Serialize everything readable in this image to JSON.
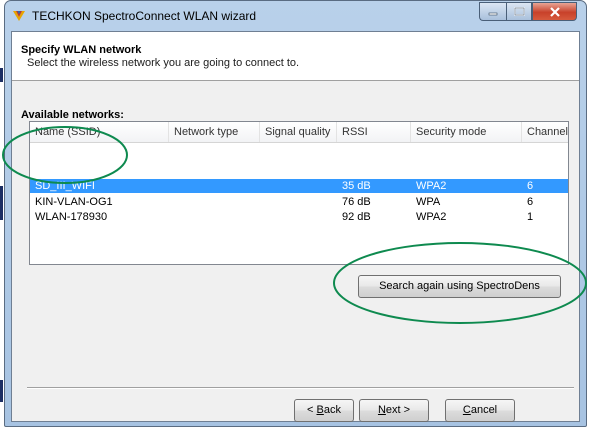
{
  "window": {
    "title": "TECHKON SpectroConnect WLAN wizard",
    "controls": {
      "minimize": "–",
      "maximize": "□",
      "close": "✕"
    }
  },
  "header": {
    "title": "Specify WLAN network",
    "subtitle": "Select the wireless network you are going to connect to."
  },
  "networks": {
    "label": "Available networks:",
    "columns": [
      "Name (SSID)",
      "Network type",
      "Signal quality",
      "RSSI",
      "Security mode",
      "Channel"
    ],
    "rows": [
      {
        "ssid": "SD_III_WIFI",
        "type": "",
        "quality": "",
        "rssi": "35 dB",
        "security": "WPA2",
        "channel": "6",
        "selected": true
      },
      {
        "ssid": "KIN-VLAN-OG1",
        "type": "",
        "quality": "",
        "rssi": "76 dB",
        "security": "WPA",
        "channel": "6",
        "selected": false
      },
      {
        "ssid": "WLAN-178930",
        "type": "",
        "quality": "",
        "rssi": "92 dB",
        "security": "WPA2",
        "channel": "1",
        "selected": false
      }
    ]
  },
  "buttons": {
    "search_again": "Search again using SpectroDens",
    "back_prefix": "< ",
    "back_key": "B",
    "back_rest": "ack",
    "next_key": "N",
    "next_rest": "ext >",
    "cancel_key": "C",
    "cancel_rest": "ancel"
  },
  "colors": {
    "selection": "#3399ff",
    "annotation": "#0e8a4f",
    "titlebar": "#b9d1ea",
    "close_button": "#c8412a"
  },
  "icons": {
    "app": "techkon-logo-icon"
  }
}
